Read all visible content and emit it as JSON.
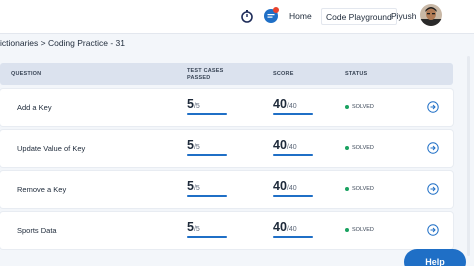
{
  "header": {
    "nav_home": "Home",
    "nav_playground": "Code Playground",
    "user_name": "Piyush"
  },
  "breadcrumb": "ictionaries > Coding Practice - 31",
  "table": {
    "columns": {
      "question": "QUESTION",
      "test_cases": "TEST CASES PASSED",
      "score": "SCORE",
      "status": "STATUS"
    },
    "rows": [
      {
        "question": "Add a Key",
        "tests_passed": "5",
        "tests_total": "/5",
        "score": "40",
        "score_max": "/40",
        "status": "SOLVED"
      },
      {
        "question": "Update Value of Key",
        "tests_passed": "5",
        "tests_total": "/5",
        "score": "40",
        "score_max": "/40",
        "status": "SOLVED"
      },
      {
        "question": "Remove a Key",
        "tests_passed": "5",
        "tests_total": "/5",
        "score": "40",
        "score_max": "/40",
        "status": "SOLVED"
      },
      {
        "question": "Sports Data",
        "tests_passed": "5",
        "tests_total": "/5",
        "score": "40",
        "score_max": "/40",
        "status": "SOLVED"
      }
    ]
  },
  "help_label": "Help",
  "colors": {
    "accent": "#1f6fc6",
    "solved": "#1aa260",
    "notification": "#e8412c"
  }
}
